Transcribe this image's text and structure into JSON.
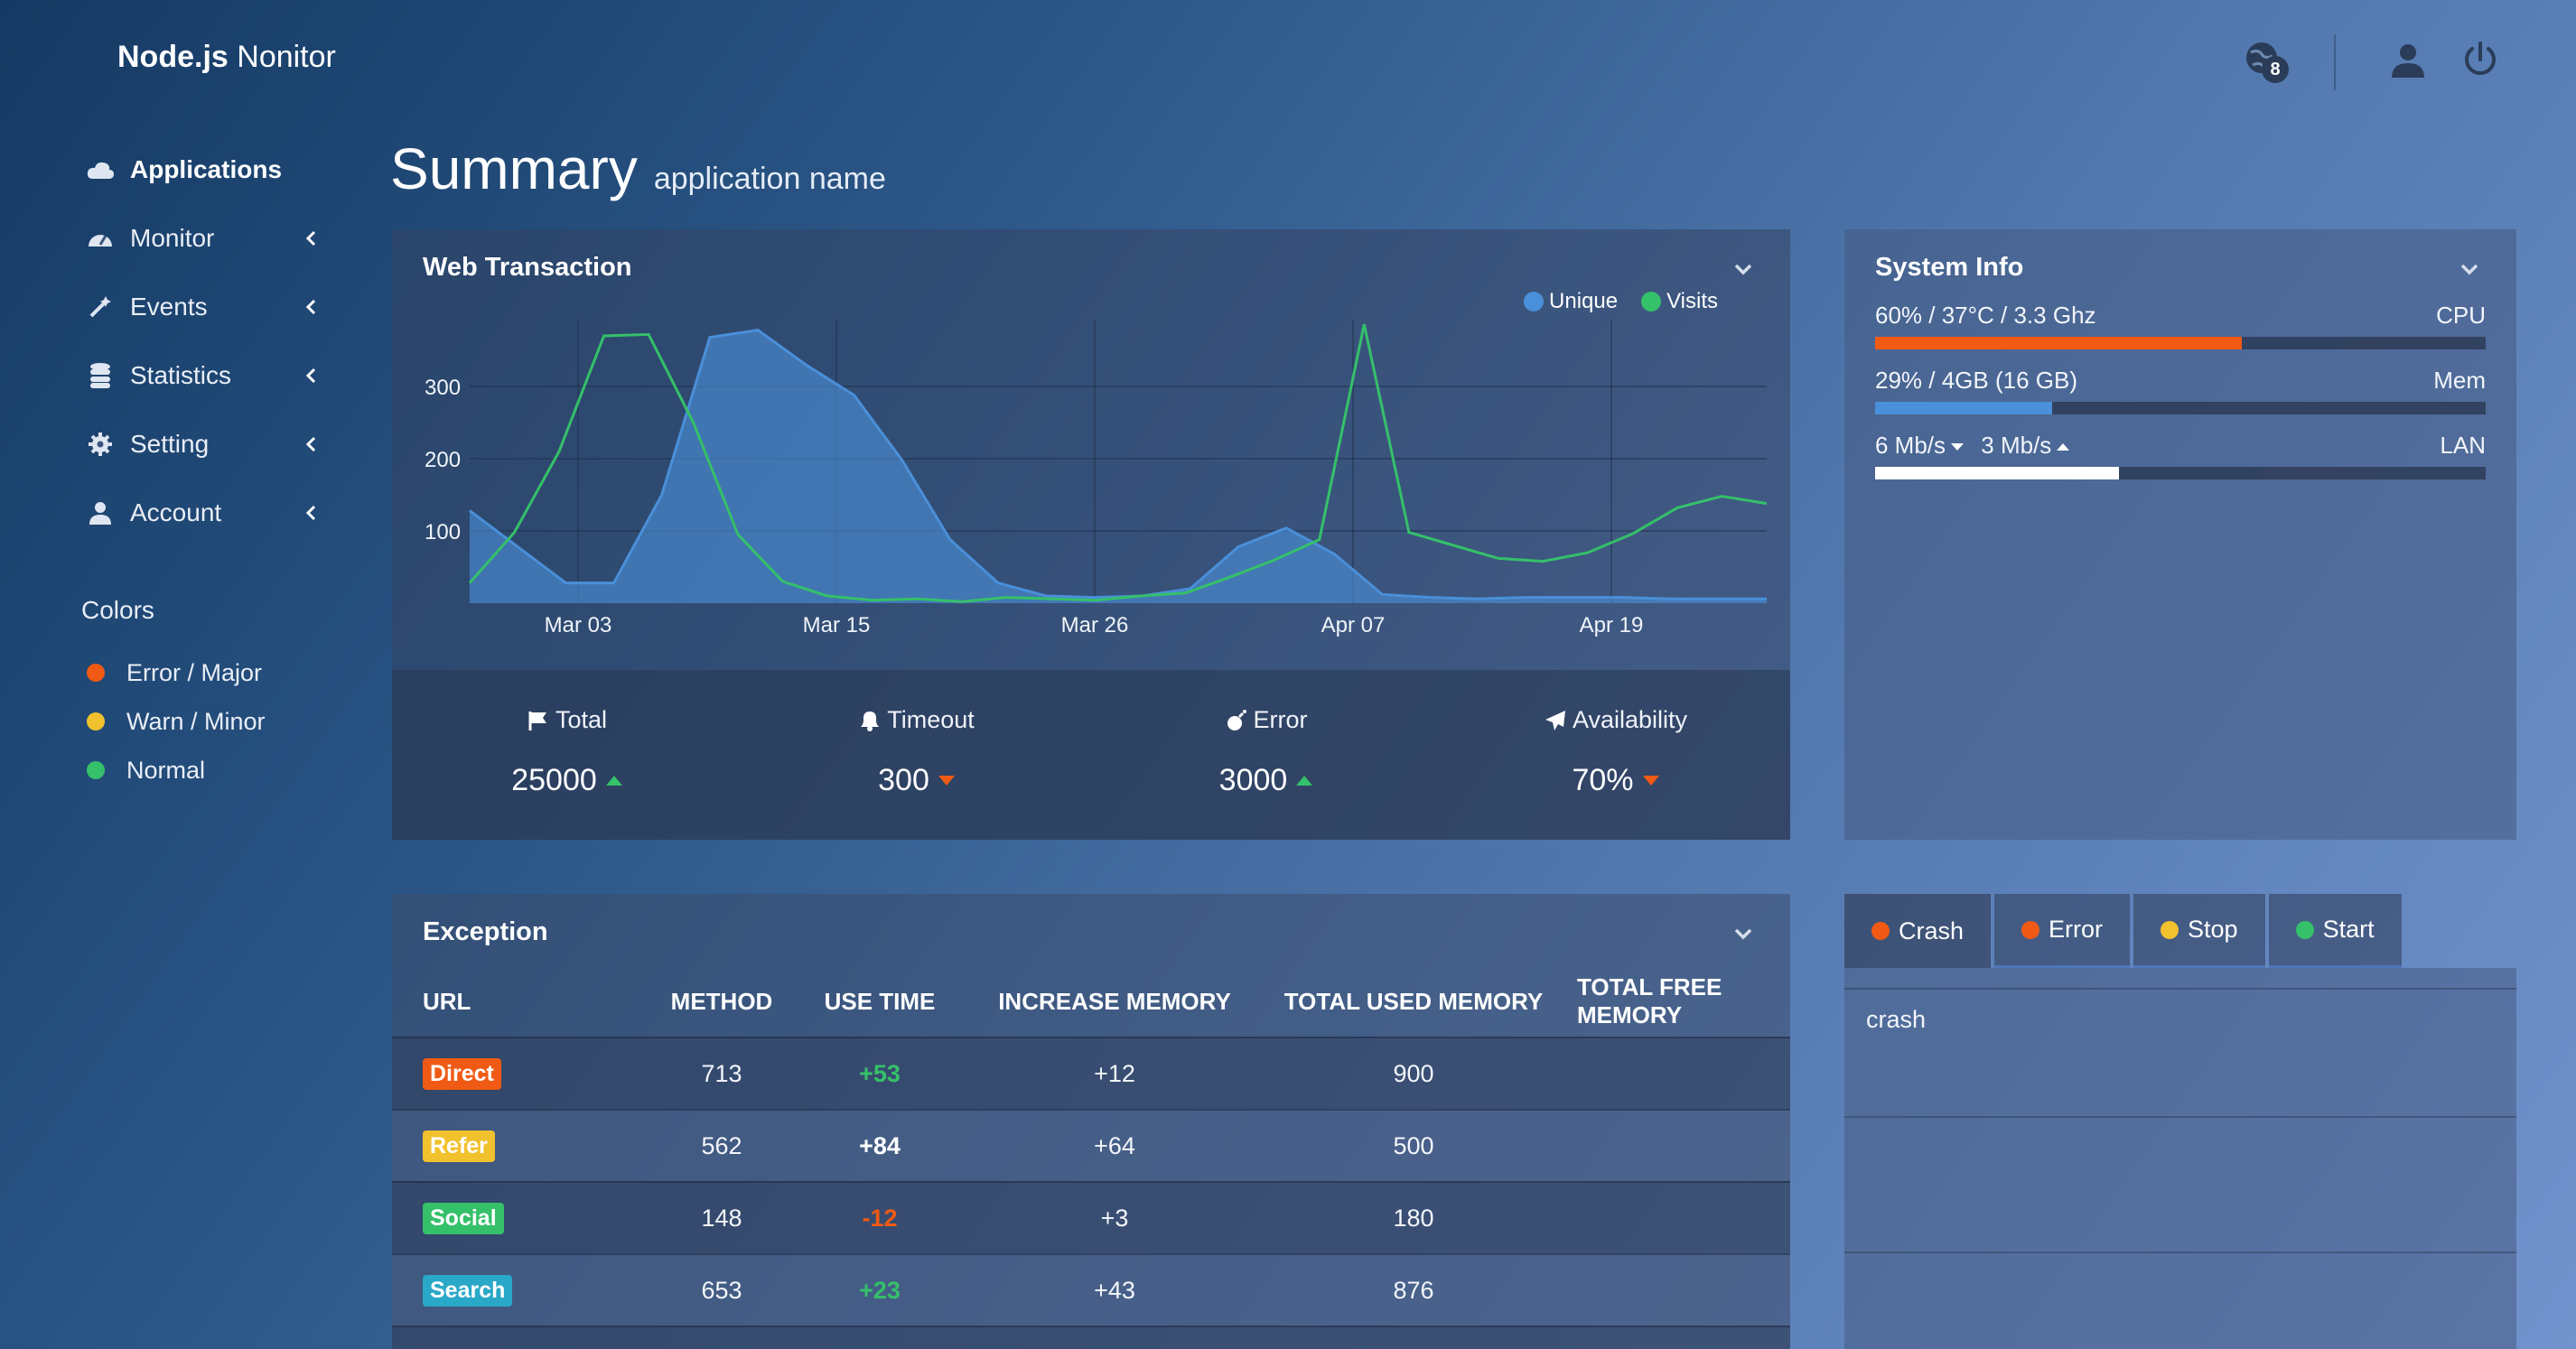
{
  "brand": {
    "bold": "Node.js",
    "rest": " Nonitor"
  },
  "notifications": {
    "count": "8"
  },
  "sidebar": {
    "items": [
      {
        "label": "Applications",
        "icon": "cloud-icon"
      },
      {
        "label": "Monitor",
        "icon": "dashboard-icon"
      },
      {
        "label": "Events",
        "icon": "magic-wand-icon"
      },
      {
        "label": "Statistics",
        "icon": "database-icon"
      },
      {
        "label": "Setting",
        "icon": "gear-icon"
      },
      {
        "label": "Account",
        "icon": "user-icon"
      }
    ],
    "colors_title": "Colors",
    "colors": [
      {
        "label": "Error / Major",
        "color": "#f05a14"
      },
      {
        "label": "Warn / Minor",
        "color": "#f2c12e"
      },
      {
        "label": "Normal",
        "color": "#35c06a"
      }
    ]
  },
  "heading": {
    "title": "Summary",
    "subtitle": "application name"
  },
  "web_transaction": {
    "title": "Web Transaction",
    "legend": [
      {
        "label": "Unique",
        "color": "#4a8fd9"
      },
      {
        "label": "Visits",
        "color": "#35c06a"
      }
    ],
    "stats": [
      {
        "label": "Total",
        "value": "25000",
        "trend": "up",
        "icon": "flag-icon"
      },
      {
        "label": "Timeout",
        "value": "300",
        "trend": "down",
        "icon": "bell-icon"
      },
      {
        "label": "Error",
        "value": "3000",
        "trend": "up",
        "icon": "bomb-icon"
      },
      {
        "label": "Availability",
        "value": "70%",
        "trend": "down",
        "icon": "paper-plane-icon"
      }
    ]
  },
  "chart_data": {
    "type": "area",
    "ylim": [
      0,
      380
    ],
    "yticks": [
      100,
      200,
      300
    ],
    "x_tick_labels": [
      {
        "label": "Mar 03",
        "index": 3
      },
      {
        "label": "Mar 15",
        "index": 8
      },
      {
        "label": "Mar 26",
        "index": 13
      },
      {
        "label": "Apr 07",
        "index": 18
      },
      {
        "label": "Apr 19",
        "index": 23
      }
    ],
    "grid": true,
    "legend_position": "top-right",
    "series": [
      {
        "name": "Unique",
        "color": "#4a8fd9",
        "fill": true,
        "values": [
          128,
          78,
          28,
          28,
          150,
          368,
          378,
          330,
          288,
          198,
          88,
          28,
          10,
          8,
          10,
          20,
          78,
          104,
          68,
          12,
          8,
          6,
          8,
          8,
          8,
          6,
          6,
          6
        ]
      },
      {
        "name": "Visits",
        "color": "#35c06a",
        "fill": false,
        "values": [
          28,
          98,
          210,
          370,
          372,
          250,
          95,
          30,
          10,
          4,
          6,
          2,
          8,
          6,
          4,
          10,
          14,
          36,
          60,
          88,
          386,
          98,
          80,
          62,
          58,
          70,
          96,
          132,
          148,
          138
        ]
      }
    ]
  },
  "system_info": {
    "title": "System Info",
    "metrics": [
      {
        "left": "60% / 37°C / 3.3 Ghz",
        "right": "CPU",
        "percent": 60,
        "color": "#f05a14"
      },
      {
        "left": "29% / 4GB (16 GB)",
        "right": "Mem",
        "percent": 29,
        "color": "#4a8fd9"
      },
      {
        "down": "6 Mb/s",
        "up": "3 Mb/s",
        "right": "LAN",
        "percent": 40,
        "color": "#ffffff"
      }
    ]
  },
  "exception": {
    "title": "Exception",
    "columns": [
      "URL",
      "METHOD",
      "USE TIME",
      "INCREASE MEMORY",
      "TOTAL USED MEMORY",
      "TOTAL FREE MEMORY"
    ],
    "rows": [
      {
        "tag": "Direct",
        "tag_color": "#f05a14",
        "method": "713",
        "use_time": "+53",
        "use_color": "#35c06a",
        "inc": "+12",
        "total": "900",
        "free": ""
      },
      {
        "tag": "Refer",
        "tag_color": "#f2c12e",
        "method": "562",
        "use_time": "+84",
        "use_color": "#ffffff",
        "inc": "+64",
        "total": "500",
        "free": ""
      },
      {
        "tag": "Social",
        "tag_color": "#35c06a",
        "method": "148",
        "use_time": "-12",
        "use_color": "#f05a14",
        "inc": "+3",
        "total": "180",
        "free": ""
      },
      {
        "tag": "Search",
        "tag_color": "#2aa8c8",
        "method": "653",
        "use_time": "+23",
        "use_color": "#35c06a",
        "inc": "+43",
        "total": "876",
        "free": ""
      }
    ]
  },
  "events_panel": {
    "tabs": [
      {
        "label": "Crash",
        "color": "#f05a14"
      },
      {
        "label": "Error",
        "color": "#f05a14"
      },
      {
        "label": "Stop",
        "color": "#f2c12e"
      },
      {
        "label": "Start",
        "color": "#35c06a"
      }
    ],
    "active_content": "crash"
  }
}
